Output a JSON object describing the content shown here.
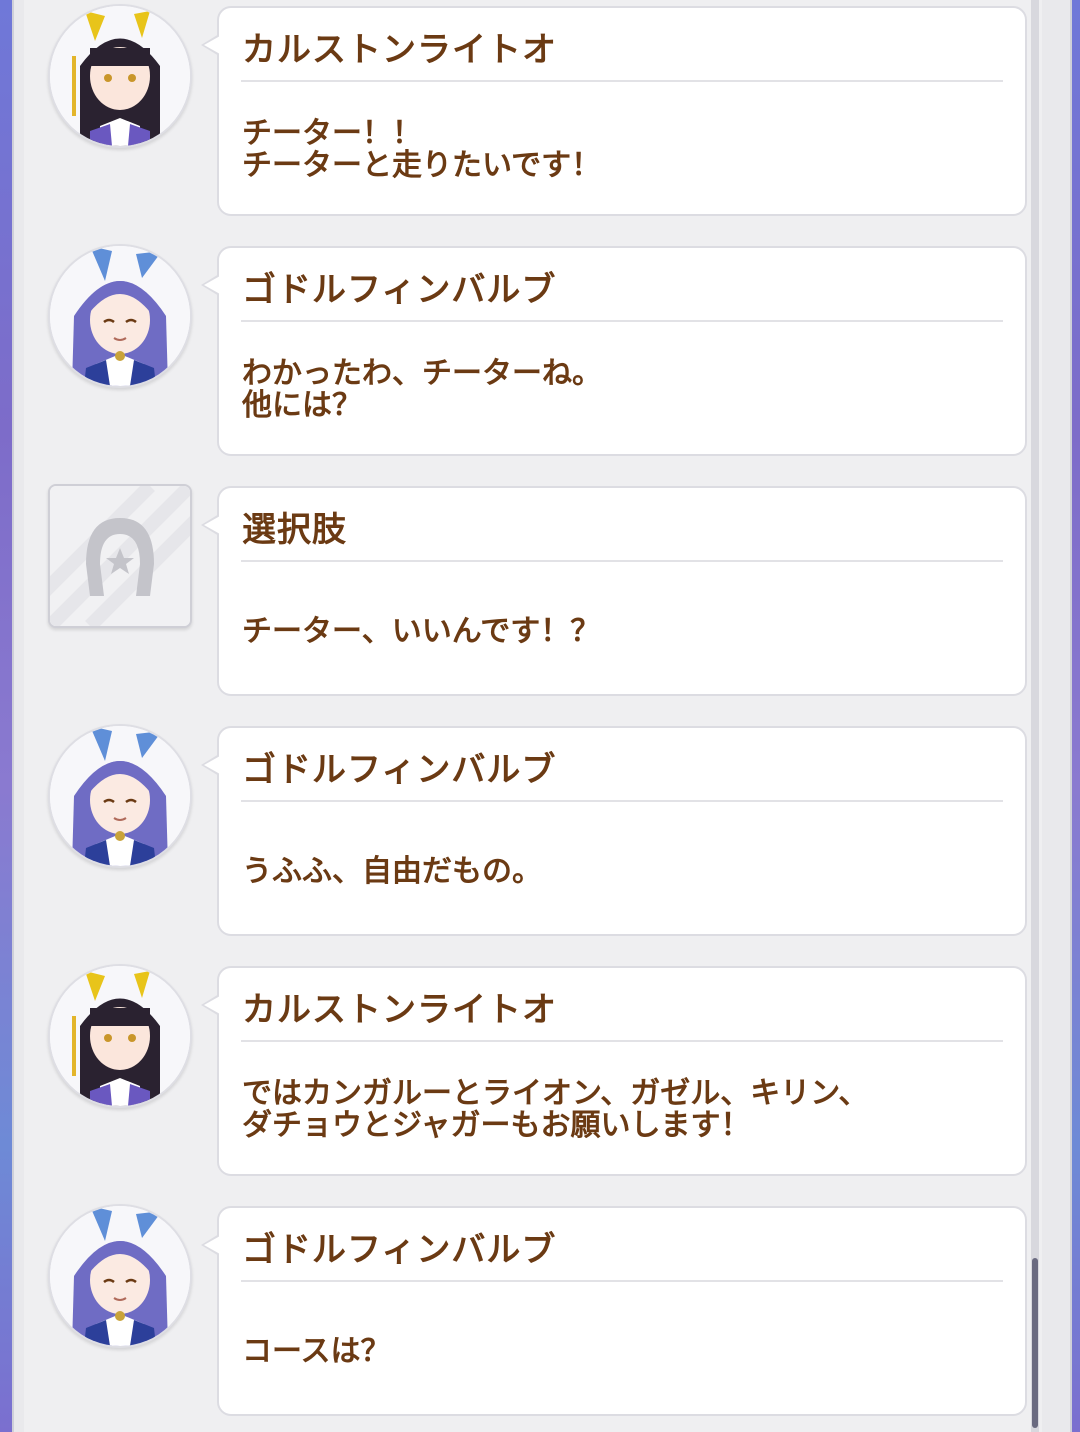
{
  "dialogue_log": [
    {
      "speaker": "カルストンライトオ",
      "message": "チーター！！\nチーターと走りたいです！",
      "avatar": "karsten-avatar"
    },
    {
      "speaker": "ゴドルフィンバルブ",
      "message": "わかったわ、チーターね。\n他には？",
      "avatar": "godolphin-avatar"
    },
    {
      "speaker": "選択肢",
      "message": "チーター、いいんです！？",
      "avatar": "horseshoe-icon"
    },
    {
      "speaker": "ゴドルフィンバルブ",
      "message": "うふふ、自由だもの。",
      "avatar": "godolphin-avatar"
    },
    {
      "speaker": "カルストンライトオ",
      "message": "ではカンガルーとライオン、ガゼル、キリン、\nダチョウとジャガーもお願いします！",
      "avatar": "karsten-avatar"
    },
    {
      "speaker": "ゴドルフィンバルブ",
      "message": "コースは？",
      "avatar": "godolphin-avatar"
    }
  ],
  "colors": {
    "text_brown": "#6b3a13",
    "bubble_bg": "#ffffff",
    "log_bg": "#efeff1"
  }
}
